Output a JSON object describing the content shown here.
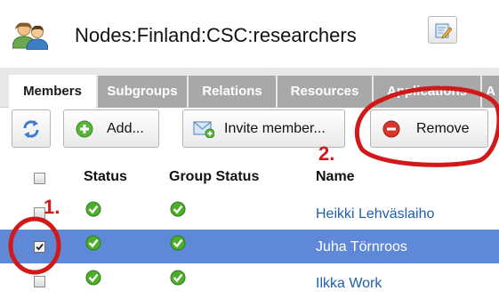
{
  "header": {
    "title": "Nodes:Finland:CSC:researchers"
  },
  "tabs": [
    {
      "label": "Members",
      "active": true
    },
    {
      "label": "Subgroups",
      "active": false
    },
    {
      "label": "Relations",
      "active": false
    },
    {
      "label": "Resources",
      "active": false
    },
    {
      "label": "Applications",
      "active": false
    },
    {
      "label": "A",
      "active": false
    }
  ],
  "toolbar": {
    "add_label": "Add...",
    "invite_label": "Invite member...",
    "remove_label": "Remove"
  },
  "table": {
    "columns": [
      "Status",
      "Group Status",
      "Name"
    ],
    "rows": [
      {
        "checked": false,
        "status": "ok",
        "group_status": "ok",
        "name": "Heikki Lehväslaiho",
        "selected": false
      },
      {
        "checked": true,
        "status": "ok",
        "group_status": "ok",
        "name": "Juha Törnroos",
        "selected": true
      },
      {
        "checked": false,
        "status": "ok",
        "group_status": "ok",
        "name": "Ilkka Work",
        "selected": false
      }
    ]
  },
  "annotations": {
    "step1": "1.",
    "step2": "2."
  },
  "colors": {
    "selected_row": "#5f88d6",
    "link": "#1f5fb0",
    "annotation": "#d11919",
    "ok_green": "#4caf2a",
    "remove_red": "#d9342b"
  }
}
